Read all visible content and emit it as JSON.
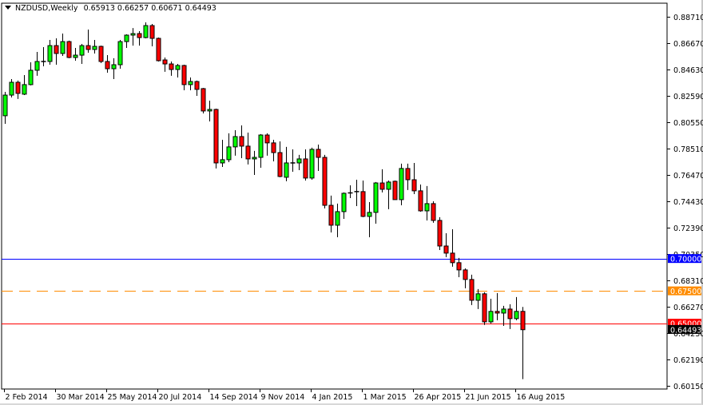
{
  "chart_data": {
    "type": "candlestick",
    "title": "NZDUSD,Weekly",
    "symbol": "NZDUSD",
    "timeframe": "Weekly",
    "header_ohlc": [
      "0.65913",
      "0.66257",
      "0.60671",
      "0.64493"
    ],
    "ylim": [
      0.6015,
      0.8871
    ],
    "y_ticks": [
      "0.88710",
      "0.86670",
      "0.84630",
      "0.82590",
      "0.80550",
      "0.78510",
      "0.76470",
      "0.74430",
      "0.72390",
      "0.70350",
      "0.68310",
      "0.66270",
      "0.64230",
      "0.62190",
      "0.60150"
    ],
    "x_ticks": [
      {
        "index": 0,
        "label": "2 Feb 2014"
      },
      {
        "index": 8,
        "label": "30 Mar 2014"
      },
      {
        "index": 16,
        "label": "25 May 2014"
      },
      {
        "index": 24,
        "label": "20 Jul 2014"
      },
      {
        "index": 32,
        "label": "14 Sep 2014"
      },
      {
        "index": 40,
        "label": "9 Nov 2014"
      },
      {
        "index": 48,
        "label": "4 Jan 2015"
      },
      {
        "index": 56,
        "label": "1 Mar 2015"
      },
      {
        "index": 64,
        "label": "26 Apr 2015"
      },
      {
        "index": 72,
        "label": "21 Jun 2015"
      },
      {
        "index": 80,
        "label": "16 Aug 2015"
      }
    ],
    "ohlc": [
      [
        0.8105,
        0.829,
        0.8043,
        0.8265
      ],
      [
        0.8265,
        0.8389,
        0.8247,
        0.8364
      ],
      [
        0.8364,
        0.8377,
        0.8235,
        0.8278
      ],
      [
        0.8272,
        0.842,
        0.8265,
        0.8346
      ],
      [
        0.8346,
        0.8519,
        0.834,
        0.8457
      ],
      [
        0.8457,
        0.8599,
        0.8414,
        0.8525
      ],
      [
        0.8525,
        0.8636,
        0.8488,
        0.8522
      ],
      [
        0.8525,
        0.8692,
        0.85,
        0.8648
      ],
      [
        0.8648,
        0.8704,
        0.85,
        0.8587
      ],
      [
        0.8587,
        0.8741,
        0.8568,
        0.8679
      ],
      [
        0.8679,
        0.8686,
        0.855,
        0.8556
      ],
      [
        0.8556,
        0.863,
        0.8531,
        0.8574
      ],
      [
        0.8574,
        0.8661,
        0.8506,
        0.8648
      ],
      [
        0.8648,
        0.8772,
        0.8593,
        0.8618
      ],
      [
        0.8618,
        0.8692,
        0.8587,
        0.8642
      ],
      [
        0.8642,
        0.8648,
        0.8513,
        0.8525
      ],
      [
        0.8525,
        0.8574,
        0.8438,
        0.8469
      ],
      [
        0.8469,
        0.855,
        0.8389,
        0.85
      ],
      [
        0.85,
        0.8692,
        0.8469,
        0.8679
      ],
      [
        0.8679,
        0.8735,
        0.863,
        0.8729
      ],
      [
        0.8729,
        0.8784,
        0.8648,
        0.8741
      ],
      [
        0.8741,
        0.876,
        0.8648,
        0.871
      ],
      [
        0.871,
        0.8828,
        0.8704,
        0.8803
      ],
      [
        0.8803,
        0.8815,
        0.8642,
        0.8704
      ],
      [
        0.8704,
        0.871,
        0.8525,
        0.8531
      ],
      [
        0.8537,
        0.8556,
        0.8445,
        0.8506
      ],
      [
        0.8506,
        0.8525,
        0.8414,
        0.8463
      ],
      [
        0.8463,
        0.8506,
        0.8401,
        0.8494
      ],
      [
        0.8494,
        0.85,
        0.8302,
        0.8346
      ],
      [
        0.8346,
        0.8401,
        0.8302,
        0.837
      ],
      [
        0.837,
        0.8377,
        0.8259,
        0.8309
      ],
      [
        0.8315,
        0.832,
        0.8123,
        0.8142
      ],
      [
        0.8142,
        0.8222,
        0.8061,
        0.8154
      ],
      [
        0.8154,
        0.816,
        0.7697,
        0.774
      ],
      [
        0.774,
        0.7919,
        0.7709,
        0.7765
      ],
      [
        0.7765,
        0.7969,
        0.7746,
        0.7864
      ],
      [
        0.7864,
        0.7993,
        0.7796,
        0.7944
      ],
      [
        0.7944,
        0.803,
        0.7777,
        0.787
      ],
      [
        0.787,
        0.7975,
        0.7728,
        0.7771
      ],
      [
        0.7771,
        0.7833,
        0.7647,
        0.7783
      ],
      [
        0.7783,
        0.7963,
        0.7703,
        0.7956
      ],
      [
        0.7956,
        0.7969,
        0.7796,
        0.7895
      ],
      [
        0.7895,
        0.7919,
        0.7752,
        0.782
      ],
      [
        0.782,
        0.7907,
        0.7629,
        0.7635
      ],
      [
        0.7629,
        0.7864,
        0.7598,
        0.774
      ],
      [
        0.774,
        0.7845,
        0.7672,
        0.7737
      ],
      [
        0.774,
        0.7802,
        0.7684,
        0.7771
      ],
      [
        0.7771,
        0.7845,
        0.7604,
        0.7623
      ],
      [
        0.7623,
        0.7858,
        0.761,
        0.7845
      ],
      [
        0.7845,
        0.7882,
        0.7678,
        0.7783
      ],
      [
        0.7783,
        0.7802,
        0.7388,
        0.7412
      ],
      [
        0.7412,
        0.7487,
        0.7202,
        0.7258
      ],
      [
        0.7258,
        0.7425,
        0.7165,
        0.7363
      ],
      [
        0.7363,
        0.7512,
        0.7307,
        0.7505
      ],
      [
        0.7505,
        0.7567,
        0.7468,
        0.7508
      ],
      [
        0.7515,
        0.761,
        0.7406,
        0.7518
      ],
      [
        0.7518,
        0.7604,
        0.732,
        0.7326
      ],
      [
        0.7326,
        0.7437,
        0.7165,
        0.7357
      ],
      [
        0.7357,
        0.7592,
        0.727,
        0.7585
      ],
      [
        0.7585,
        0.7691,
        0.7512,
        0.7536
      ],
      [
        0.7536,
        0.7604,
        0.7382,
        0.7592
      ],
      [
        0.7598,
        0.7604,
        0.7456,
        0.7456
      ],
      [
        0.7456,
        0.7734,
        0.7412,
        0.7697
      ],
      [
        0.7697,
        0.7734,
        0.753,
        0.761
      ],
      [
        0.761,
        0.774,
        0.7499,
        0.7524
      ],
      [
        0.7524,
        0.7573,
        0.7363,
        0.7369
      ],
      [
        0.7369,
        0.7561,
        0.7295,
        0.7425
      ],
      [
        0.7425,
        0.7443,
        0.7277,
        0.7295
      ],
      [
        0.7295,
        0.732,
        0.7066,
        0.7097
      ],
      [
        0.7097,
        0.7196,
        0.7011,
        0.7042
      ],
      [
        0.7042,
        0.7227,
        0.6937,
        0.6968
      ],
      [
        0.6968,
        0.7005,
        0.6856,
        0.6912
      ],
      [
        0.6912,
        0.6924,
        0.677,
        0.6838
      ],
      [
        0.6838,
        0.6875,
        0.664,
        0.6677
      ],
      [
        0.6677,
        0.6764,
        0.6609,
        0.6727
      ],
      [
        0.6727,
        0.6739,
        0.6486,
        0.651
      ],
      [
        0.651,
        0.6689,
        0.6498,
        0.6591
      ],
      [
        0.6591,
        0.6733,
        0.6523,
        0.6578
      ],
      [
        0.6578,
        0.6634,
        0.6479,
        0.6609
      ],
      [
        0.6609,
        0.6646,
        0.6455,
        0.6535
      ],
      [
        0.6535,
        0.6702,
        0.6523,
        0.6591
      ],
      [
        0.65913,
        0.66257,
        0.60671,
        0.64493
      ]
    ],
    "horizontal_lines": [
      {
        "price": 0.7,
        "label": "0.70000",
        "color": "#0000ff",
        "style": "solid"
      },
      {
        "price": 0.675,
        "label": "0.67500",
        "color": "#ff8c00",
        "style": "dashed"
      },
      {
        "price": 0.65,
        "label": "0.65000",
        "color": "#ff0000",
        "style": "solid"
      }
    ],
    "last_price": {
      "price": 0.64493,
      "label": "0.64493",
      "color": "#000000"
    },
    "colors": {
      "bull": "#00ff00",
      "bear": "#ff0000",
      "outline": "#000000"
    }
  }
}
